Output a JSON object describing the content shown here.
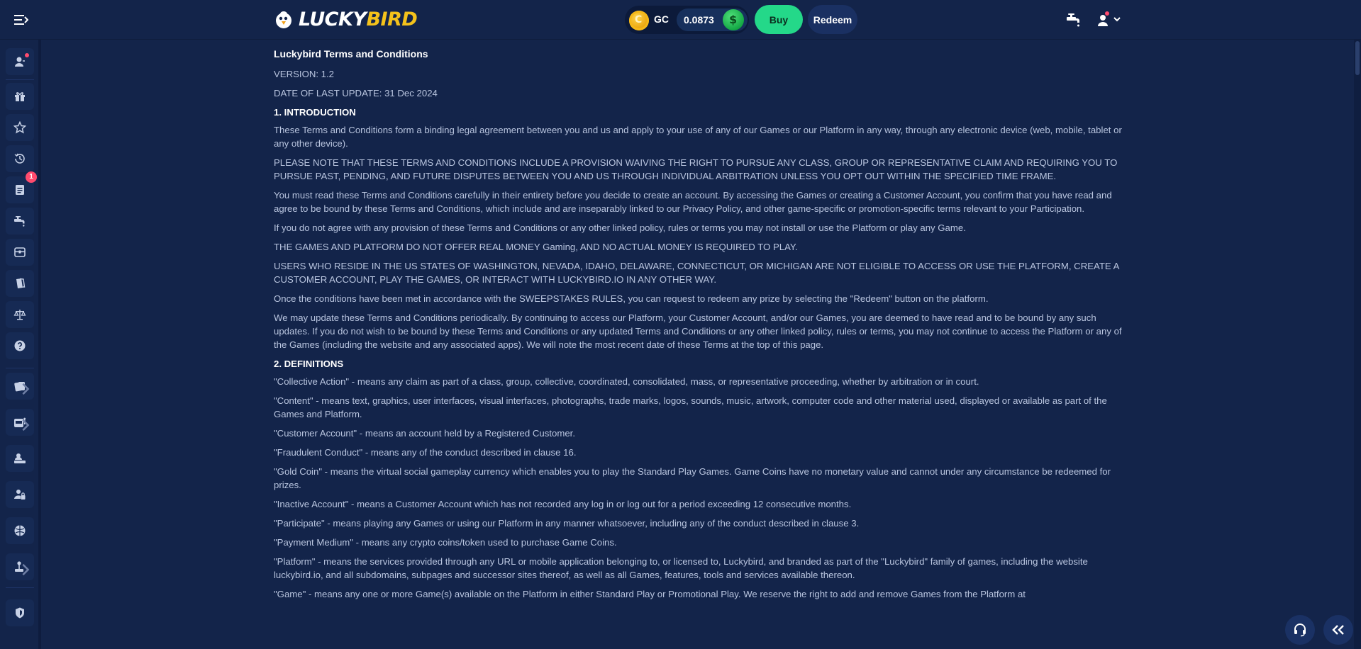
{
  "header": {
    "logo": {
      "text_main": "LUCKY",
      "text_accent": "BIRD"
    },
    "wallet": {
      "currency": "GC",
      "balance": "0.0873"
    },
    "buy_label": "Buy",
    "redeem_label": "Redeem"
  },
  "sidebar": {
    "items": [
      {
        "name": "profile-item",
        "icon": "user-icon"
      },
      {
        "name": "rewards-item",
        "icon": "gift-icon"
      },
      {
        "name": "favorites-item",
        "icon": "star-icon"
      },
      {
        "name": "history-item",
        "icon": "history-icon"
      },
      {
        "name": "tasks-item",
        "icon": "list-icon",
        "badge": "1"
      },
      {
        "name": "faucet-item",
        "icon": "faucet-icon"
      },
      {
        "name": "cases-item",
        "icon": "box-icon"
      },
      {
        "name": "docs-item",
        "icon": "document-icon"
      },
      {
        "name": "legal-item",
        "icon": "scales-icon"
      },
      {
        "name": "help-item",
        "icon": "help-icon"
      },
      {
        "name": "cards-item",
        "icon": "cards-icon"
      },
      {
        "name": "slots-item",
        "icon": "slot-machine-icon"
      },
      {
        "name": "live-item",
        "icon": "dealer-icon"
      },
      {
        "name": "vip-item",
        "icon": "lock-person-icon"
      },
      {
        "name": "sports-item",
        "icon": "ball-icon"
      },
      {
        "name": "originals-item",
        "icon": "joystick-icon"
      },
      {
        "name": "security-item",
        "icon": "shield-icon"
      }
    ]
  },
  "content": {
    "title": "Luckybird Terms and Conditions",
    "version": "VERSION: 1.2",
    "last_update": "DATE OF LAST UPDATE: 31 Dec 2024",
    "sections": [
      {
        "heading": "1. INTRODUCTION",
        "paragraphs": [
          "These Terms and Conditions form a binding legal agreement between you and us and apply to your use of any of our Games or our Platform in any way, through any electronic device (web, mobile, tablet or any other device).",
          "PLEASE NOTE THAT THESE TERMS AND CONDITIONS INCLUDE A PROVISION WAIVING THE RIGHT TO PURSUE ANY CLASS, GROUP OR REPRESENTATIVE CLAIM AND REQUIRING YOU TO PURSUE PAST, PENDING, AND FUTURE DISPUTES BETWEEN YOU AND US THROUGH INDIVIDUAL ARBITRATION UNLESS YOU OPT OUT WITHIN THE SPECIFIED TIME FRAME.",
          "You must read these Terms and Conditions carefully in their entirety before you decide to create an account. By accessing the Games or creating a Customer Account, you confirm that you have read and agree to be bound by these Terms and Conditions, which include and are inseparably linked to our Privacy Policy, and other game-specific or promotion-specific terms relevant to your Participation.",
          "If you do not agree with any provision of these Terms and Conditions or any other linked policy, rules or terms you may not install or use the Platform or play any Game.",
          "THE GAMES AND PLATFORM DO NOT OFFER REAL MONEY Gaming, AND NO ACTUAL MONEY IS REQUIRED TO PLAY.",
          "USERS WHO RESIDE IN THE US STATES OF WASHINGTON, NEVADA, IDAHO, DELAWARE, CONNECTICUT, OR MICHIGAN ARE NOT ELIGIBLE TO ACCESS OR USE THE PLATFORM, CREATE A CUSTOMER ACCOUNT, PLAY THE GAMES, OR INTERACT WITH LUCKYBIRD.IO IN ANY OTHER WAY.",
          "Once the conditions have been met in accordance with the SWEEPSTAKES RULES, you can request to redeem any prize by selecting the \"Redeem\" button on the platform.",
          "We may update these Terms and Conditions periodically. By continuing to access our Platform, your Customer Account, and/or our Games, you are deemed to have read and to be bound by any such updates. If you do not wish to be bound by these Terms and Conditions or any updated Terms and Conditions or any other linked policy, rules or terms, you may not continue to access the Platform or any of the Games (including the website and any associated apps). We will note the most recent date of these Terms at the top of this page."
        ]
      },
      {
        "heading": "2. DEFINITIONS",
        "paragraphs": [
          "\"Collective Action\" - means any claim as part of a class, group, collective, coordinated, consolidated, mass, or representative proceeding, whether by arbitration or in court.",
          "\"Content\" - means text, graphics, user interfaces, visual interfaces, photographs, trade marks, logos, sounds, music, artwork, computer code and other material used, displayed or available as part of the Games and Platform.",
          "\"Customer Account\" - means an account held by a Registered Customer.",
          "\"Fraudulent Conduct\" - means any of the conduct described in clause 16.",
          "\"Gold Coin\" - means the virtual social gameplay currency which enables you to play the Standard Play Games. Game Coins have no monetary value and cannot under any circumstance be redeemed for prizes.",
          "\"Inactive Account\" - means a Customer Account which has not recorded any log in or log out for a period exceeding 12 consecutive months.",
          "\"Participate\" - means playing any Games or using our Platform in any manner whatsoever, including any of the conduct described in clause 3.",
          "\"Payment Medium\" - means any crypto coins/token used to purchase Game Coins.",
          "\"Platform\" - means the services provided through any URL or mobile application belonging to, or licensed to, Luckybird, and branded as part of the \"Luckybird\" family of games, including the website luckybird.io, and all subdomains, subpages and successor sites thereof, as well as all Games, features, tools and services available thereon.",
          "\"Game\" - means any one or more Game(s) available on the Platform in either Standard Play or Promotional Play. We reserve the right to add and remove Games from the Platform at"
        ]
      }
    ]
  }
}
